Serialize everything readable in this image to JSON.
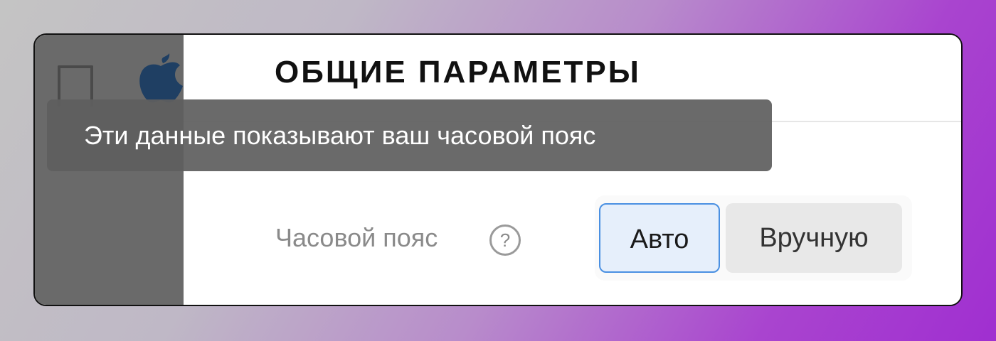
{
  "header": {
    "title": "ОБЩИЕ ПАРАМЕТРЫ"
  },
  "sidebar": {
    "toggle_icon": "sidebar-toggle-icon",
    "logo_icon": "apple-logo-icon"
  },
  "settings": {
    "timezone_label": "Часовой пояс",
    "help_glyph": "?",
    "options": [
      {
        "label": "Авто",
        "selected": true
      },
      {
        "label": "Вручную",
        "selected": false
      }
    ]
  },
  "tooltip": {
    "text": "Эти данные показывают ваш часовой пояс"
  },
  "colors": {
    "selected_border": "#4a90e2",
    "selected_bg": "#e6effb",
    "tooltip_bg": "#5f5f5f"
  }
}
